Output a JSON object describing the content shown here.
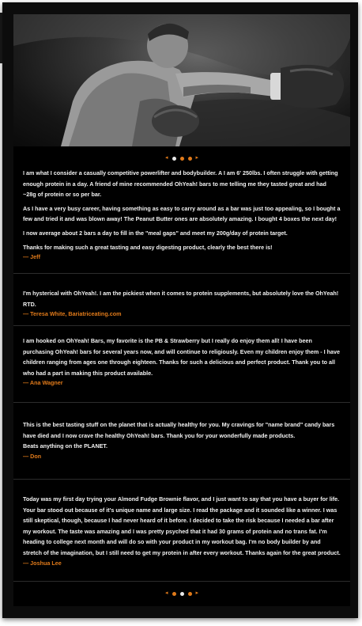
{
  "hero": {
    "image": "boxer-punch-photo"
  },
  "carousel_top": {
    "prev": "◂",
    "next": "▸",
    "dot_count": 3,
    "active_index": 0
  },
  "carousel_bottom": {
    "prev": "◂",
    "next": "▸",
    "dot_count": 3,
    "active_index": 1
  },
  "testimonials": [
    {
      "paragraphs": [
        "I am what I consider a casually competitive powerlifter and bodybuilder. A I am 6' 250lbs. I often struggle with getting enough protein in a day. A friend of mine recommended OhYeah! bars to me telling me they tasted great and had ~28g of protein or so per bar.",
        "As I have a very busy career, having something as easy to carry around as a bar was just too appealing, so I bought a few and tried it and was blown away! The Peanut Butter ones are absolutely amazing. I bought 4 boxes the next day!",
        "I now average about 2 bars a day to fill in the \"meal gaps\" and meet my 200g/day of protein target.",
        "Thanks for making such a great tasting and easy digesting product, clearly the best there is!"
      ],
      "author": "— Jeff"
    },
    {
      "paragraphs": [
        "I'm hysterical with OhYeah!. I am the pickiest when it comes to protein supplements, but absolutely love the OhYeah! RTD."
      ],
      "author": "— Teresa White, Bariatriceating.com"
    },
    {
      "paragraphs": [
        "I am hooked on OhYeah! Bars, my favorite is the PB & Strawberry but I really do enjoy them all! I have been purchasing OhYeah! bars for several years now, and will continue to religiously. Even my children enjoy them - I have children ranging from ages one through eighteen. Thanks for such a delicious and perfect product. Thank you to all who had a part in making this product available."
      ],
      "author": "— Ana Wagner"
    },
    {
      "paragraphs": [
        "This is the best tasting stuff on the planet that is actually healthy for you. My cravings for \"name brand\" candy bars have died and I now crave the healthy OhYeah! bars. Thank you for your wonderfully made products.\nBeats anything on the PLANET."
      ],
      "author": "— Don"
    },
    {
      "paragraphs": [
        "Today was my first day trying your Almond Fudge Brownie flavor, and I just want to say that you have a buyer for life. Your bar stood out because of it's unique name and large size. I read the package and it sounded like a winner. I was still skeptical, though, because I had never heard of it before. I decided to take the risk because I needed a bar after my workout. The taste was amazing and I was pretty psyched that it had 30 grams of protein and no trans fat. I'm heading to college next month and will do so with your product in my workout bag. I'm no body builder by and stretch of the imagination, but I still need to get my protein in after every workout. Thanks again for the great product."
      ],
      "author": "— Joshua Lee"
    }
  ],
  "colors": {
    "accent": "#e07a1a",
    "text": "#f2f2f2",
    "background": "#000000"
  }
}
